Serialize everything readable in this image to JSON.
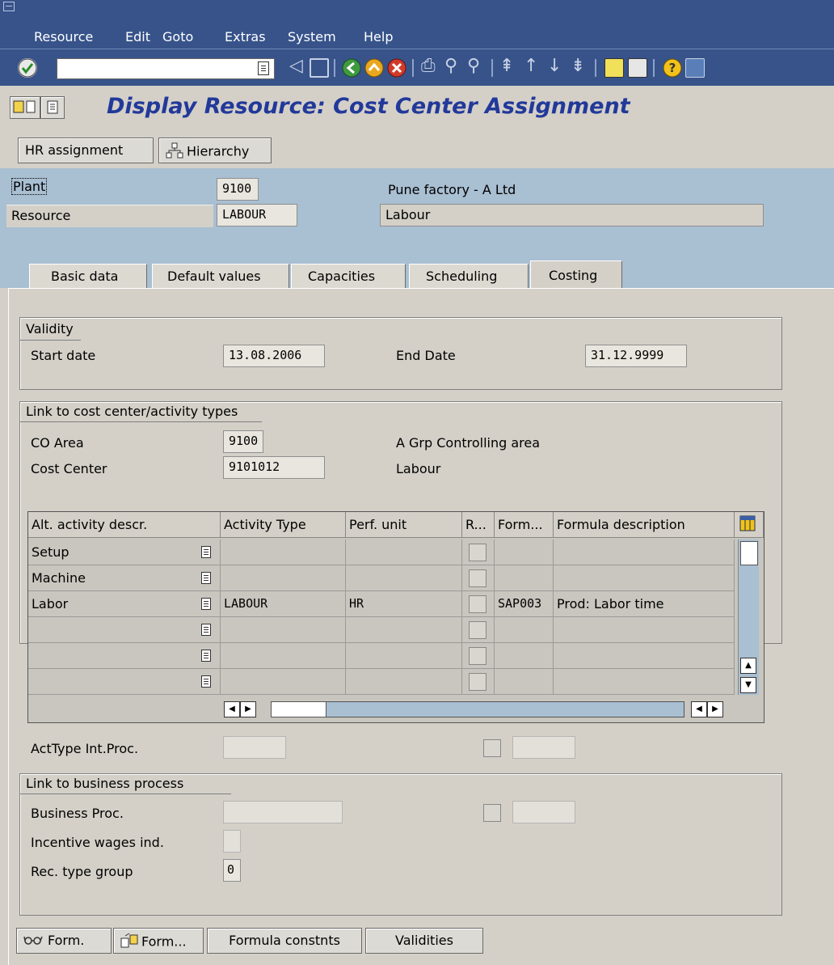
{
  "menubar": {
    "items": [
      {
        "label": "Resource"
      },
      {
        "label": "Edit"
      },
      {
        "label": "Goto"
      },
      {
        "label": "Extras"
      },
      {
        "label": "System"
      },
      {
        "label": "Help"
      }
    ]
  },
  "toolbar": {
    "command_value": ""
  },
  "title": "Display Resource: Cost Center Assignment",
  "app_toolbar": {
    "hr_assignment": "HR assignment",
    "hierarchy": "Hierarchy"
  },
  "header": {
    "plant_label": "Plant",
    "plant_value": "9100",
    "plant_desc": "Pune factory - A Ltd",
    "resource_label": "Resource",
    "resource_value": "LABOUR",
    "resource_desc": "Labour"
  },
  "tabs": [
    {
      "label": "Basic data"
    },
    {
      "label": "Default values"
    },
    {
      "label": "Capacities"
    },
    {
      "label": "Scheduling"
    },
    {
      "label": "Costing",
      "active": true
    }
  ],
  "validity": {
    "title": "Validity",
    "start_label": "Start date",
    "start_value": "13.08.2006",
    "end_label": "End Date",
    "end_value": "31.12.9999"
  },
  "link_cc": {
    "title": "Link to cost center/activity types",
    "co_area_label": "CO Area",
    "co_area_value": "9100",
    "co_area_desc": "A Grp Controlling area",
    "cost_center_label": "Cost Center",
    "cost_center_value": "9101012",
    "cost_center_desc": "Labour",
    "table": {
      "headers": [
        "Alt. activity descr.",
        "Activity Type",
        "Perf. unit",
        "R...",
        "Form...",
        "Formula description"
      ],
      "rows": [
        [
          "Setup",
          "",
          "",
          "",
          "",
          ""
        ],
        [
          "Machine",
          "",
          "",
          "",
          "",
          ""
        ],
        [
          "Labor",
          "LABOUR",
          "HR",
          "",
          "SAP003",
          "Prod: Labor time"
        ],
        [
          "",
          "",
          "",
          "",
          "",
          ""
        ],
        [
          "",
          "",
          "",
          "",
          "",
          ""
        ],
        [
          "",
          "",
          "",
          "",
          "",
          ""
        ]
      ]
    },
    "acttype_label": "ActType Int.Proc."
  },
  "link_bp": {
    "title": "Link to business process",
    "business_proc_label": "Business Proc.",
    "incentive_label": "Incentive wages ind.",
    "rec_type_label": "Rec. type group",
    "rec_type_value": "0"
  },
  "bottom_buttons": {
    "form1": "Form.",
    "form2": "Form...",
    "formula_constants": "Formula constnts",
    "validities": "Validities"
  },
  "colors": {
    "menubar_bg": "#37538a",
    "header_bg": "#a9bfd2",
    "title_color": "#22399a",
    "window_bg": "#d4d0c8"
  }
}
